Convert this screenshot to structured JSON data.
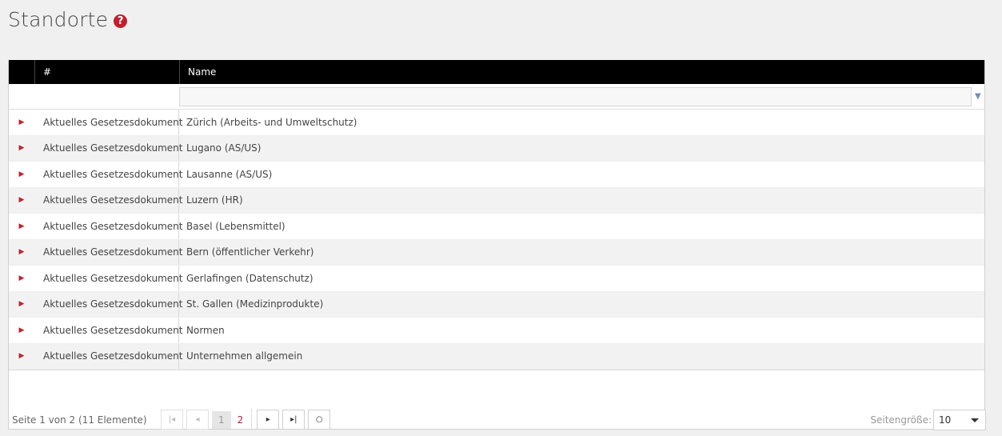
{
  "page": {
    "title": "Standorte",
    "help_icon": "question-circle-icon"
  },
  "grid": {
    "columns": [
      "#",
      "Name"
    ],
    "filter_placeholder": "",
    "rows": [
      {
        "num": "Aktuelles Gesetzesdokument",
        "name": "Zürich (Arbeits- und Umweltschutz)"
      },
      {
        "num": "Aktuelles Gesetzesdokument",
        "name": "Lugano (AS/US)"
      },
      {
        "num": "Aktuelles Gesetzesdokument",
        "name": "Lausanne (AS/US)"
      },
      {
        "num": "Aktuelles Gesetzesdokument",
        "name": "Luzern (HR)"
      },
      {
        "num": "Aktuelles Gesetzesdokument",
        "name": "Basel (Lebensmittel)"
      },
      {
        "num": "Aktuelles Gesetzesdokument",
        "name": "Bern (öffentlicher Verkehr)"
      },
      {
        "num": "Aktuelles Gesetzesdokument",
        "name": "Gerlafingen (Datenschutz)"
      },
      {
        "num": "Aktuelles Gesetzesdokument",
        "name": "St. Gallen (Medizinprodukte)"
      },
      {
        "num": "Aktuelles Gesetzesdokument",
        "name": "Normen"
      },
      {
        "num": "Aktuelles Gesetzesdokument",
        "name": "Unternehmen allgemein"
      }
    ]
  },
  "pager": {
    "info": "Seite 1 von 2 (11 Elemente)",
    "pages": [
      "1",
      "2"
    ],
    "current_page": "1",
    "page_size_label": "Seitengröße:",
    "page_size_value": "10"
  },
  "colors": {
    "accent": "#c0202f",
    "header_bg": "#000000"
  }
}
